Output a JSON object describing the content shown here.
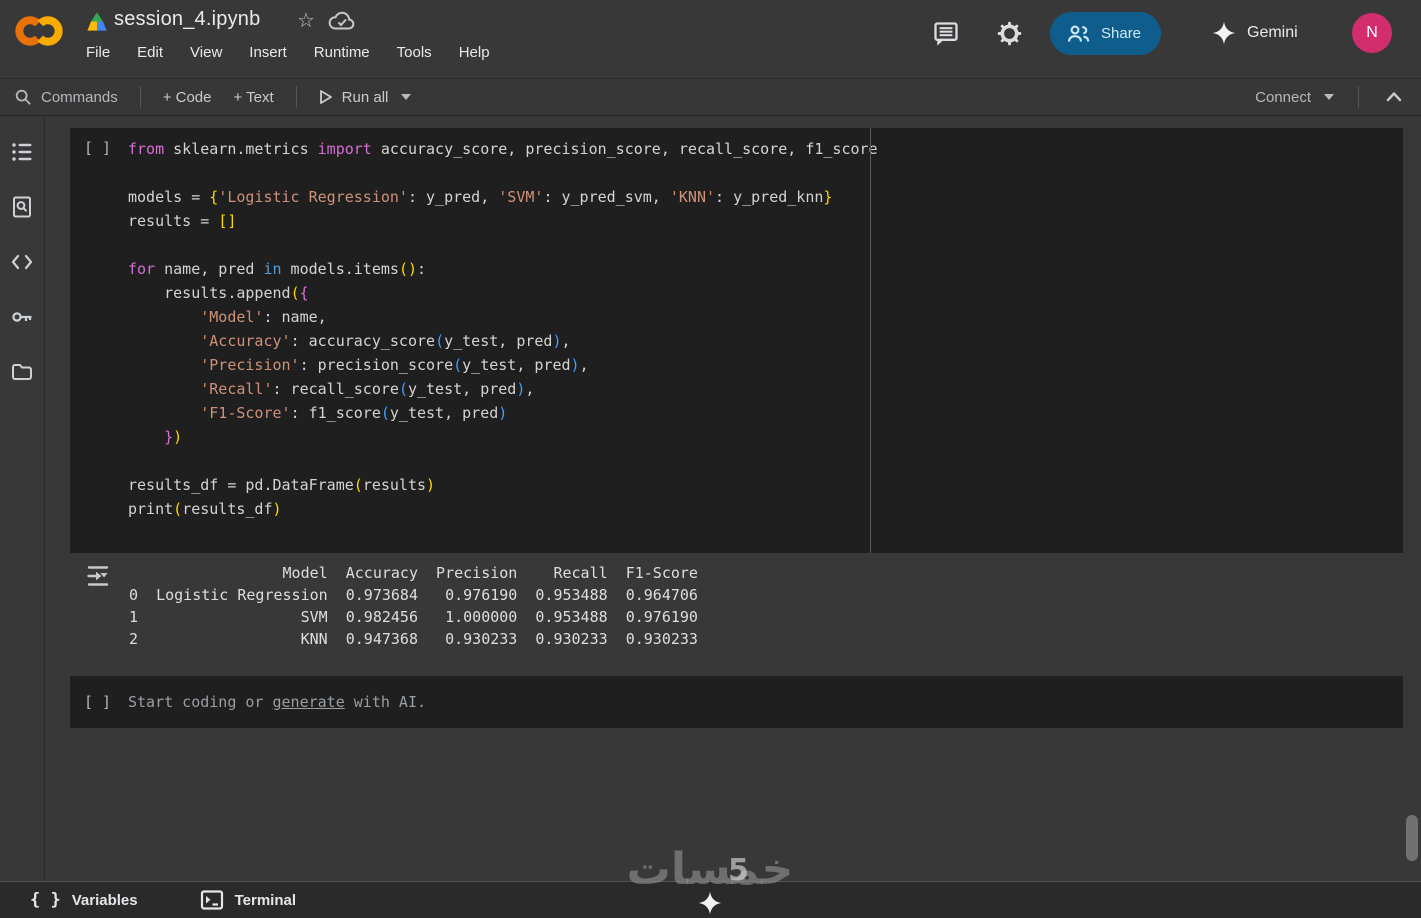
{
  "header": {
    "filename": "session_4.ipynb",
    "menu": [
      "File",
      "Edit",
      "View",
      "Insert",
      "Runtime",
      "Tools",
      "Help"
    ],
    "share_label": "Share",
    "gemini_label": "Gemini",
    "avatar_initial": "N",
    "star_glyph": "☆"
  },
  "toolbar": {
    "commands_label": "Commands",
    "add_code_label": "+ Code",
    "add_text_label": "+ Text",
    "run_all_label": "Run all",
    "connect_label": "Connect"
  },
  "sidebar": {
    "icons": [
      "table-of-contents",
      "find-and-replace",
      "code-snippets",
      "secrets",
      "files"
    ]
  },
  "notebook": {
    "code_cell": {
      "gutter": "[ ]",
      "lines": [
        [
          [
            "k",
            "from"
          ],
          [
            "p",
            " sklearn.metrics "
          ],
          [
            "k",
            "import"
          ],
          [
            "p",
            " accuracy_score, precision_score, recall_score, f1_score"
          ]
        ],
        [],
        [
          [
            "p",
            "models = "
          ],
          [
            "b1",
            "{"
          ],
          [
            "s",
            "'Logistic Regression'"
          ],
          [
            "p",
            ": y_pred, "
          ],
          [
            "s",
            "'SVM'"
          ],
          [
            "p",
            ": y_pred_svm, "
          ],
          [
            "s",
            "'KNN'"
          ],
          [
            "p",
            ": y_pred_knn"
          ],
          [
            "b1",
            "}"
          ]
        ],
        [
          [
            "p",
            "results = "
          ],
          [
            "b1",
            "[]"
          ]
        ],
        [],
        [
          [
            "k",
            "for"
          ],
          [
            "p",
            " name, pred "
          ],
          [
            "kb",
            "in"
          ],
          [
            "p",
            " models.items"
          ],
          [
            "b1",
            "()"
          ],
          [
            "p",
            ":"
          ]
        ],
        [
          [
            "p",
            "    results.append"
          ],
          [
            "b1",
            "("
          ],
          [
            "b2",
            "{"
          ]
        ],
        [
          [
            "p",
            "        "
          ],
          [
            "s",
            "'Model'"
          ],
          [
            "p",
            ": name,"
          ]
        ],
        [
          [
            "p",
            "        "
          ],
          [
            "s",
            "'Accuracy'"
          ],
          [
            "p",
            ": accuracy_score"
          ],
          [
            "b3",
            "("
          ],
          [
            "p",
            "y_test, pred"
          ],
          [
            "b3",
            ")"
          ],
          [
            "p",
            ","
          ]
        ],
        [
          [
            "p",
            "        "
          ],
          [
            "s",
            "'Precision'"
          ],
          [
            "p",
            ": precision_score"
          ],
          [
            "b3",
            "("
          ],
          [
            "p",
            "y_test, pred"
          ],
          [
            "b3",
            ")"
          ],
          [
            "p",
            ","
          ]
        ],
        [
          [
            "p",
            "        "
          ],
          [
            "s",
            "'Recall'"
          ],
          [
            "p",
            ": recall_score"
          ],
          [
            "b3",
            "("
          ],
          [
            "p",
            "y_test, pred"
          ],
          [
            "b3",
            ")"
          ],
          [
            "p",
            ","
          ]
        ],
        [
          [
            "p",
            "        "
          ],
          [
            "s",
            "'F1-Score'"
          ],
          [
            "p",
            ": f1_score"
          ],
          [
            "b3",
            "("
          ],
          [
            "p",
            "y_test, pred"
          ],
          [
            "b3",
            ")"
          ]
        ],
        [
          [
            "p",
            "    "
          ],
          [
            "b2",
            "}"
          ],
          [
            "b1",
            ")"
          ]
        ],
        [],
        [
          [
            "p",
            "results_df = pd.DataFrame"
          ],
          [
            "b1",
            "("
          ],
          [
            "p",
            "results"
          ],
          [
            "b1",
            ")"
          ]
        ],
        [
          [
            "p",
            "print"
          ],
          [
            "b1",
            "("
          ],
          [
            "p",
            "results_df"
          ],
          [
            "b1",
            ")"
          ]
        ],
        []
      ]
    },
    "output": {
      "lines": [
        "                 Model  Accuracy  Precision    Recall  F1-Score",
        "0  Logistic Regression  0.973684   0.976190  0.953488  0.964706",
        "1                  SVM  0.982456   1.000000  0.953488  0.976190",
        "2                  KNN  0.947368   0.930233  0.930233  0.930233"
      ]
    },
    "empty_cell": {
      "gutter": "[ ]",
      "placeholder_prefix": "Start coding or ",
      "placeholder_link": "generate",
      "placeholder_suffix": " with AI."
    }
  },
  "statusbar": {
    "variables_label": "Variables",
    "terminal_label": "Terminal",
    "braces_glyph": "{ }"
  },
  "watermark": {
    "text": "خمسات",
    "digit": "5"
  },
  "colors": {
    "share_bg": "#0f5d8c",
    "avatar_bg": "#d22e6e",
    "cell_bg": "#1f1f1f",
    "page_bg": "#383838"
  },
  "syntax_colors": {
    "k": "#d46ed2",
    "kb": "#569cd6",
    "s": "#ce9178",
    "b1": "#ffd700",
    "b2": "#da70d6",
    "b3": "#3f9eff",
    "p": "#d4d4d4"
  }
}
